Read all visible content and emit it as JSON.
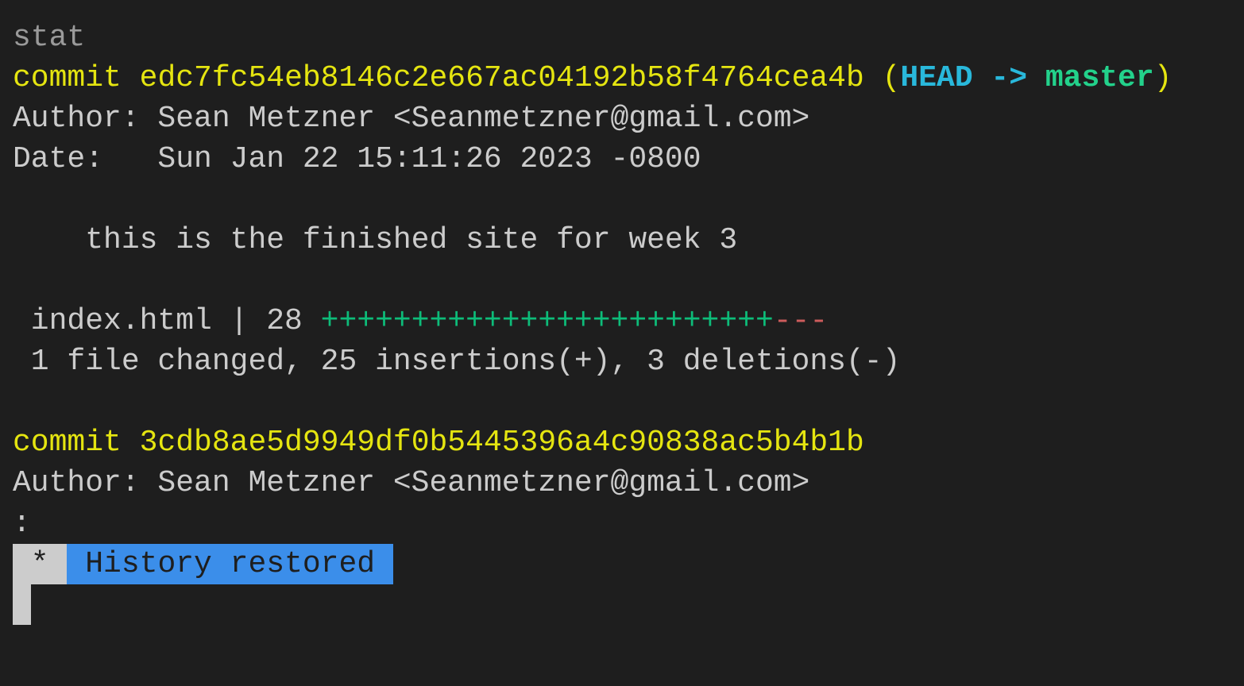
{
  "lines": {
    "prev": "stat",
    "commit1": {
      "label": "commit ",
      "hash": "edc7fc54eb8146c2e667ac04192b58f4764cea4b",
      "open": " (",
      "head": "HEAD",
      "arrow": " -> ",
      "branch": "master",
      "close": ")",
      "author": "Author: Sean Metzner <Seanmetzner@gmail.com>",
      "date": "Date:   Sun Jan 22 15:11:26 2023 -0800",
      "message": "    this is the finished site for week 3",
      "stat_file": " index.html | 28 ",
      "stat_plus": "+++++++++++++++++++++++++",
      "stat_minus": "---",
      "summary": " 1 file changed, 25 insertions(+), 3 deletions(-)"
    },
    "commit2": {
      "label": "commit ",
      "hash": "3cdb8ae5d9949df0b5445396a4c90838ac5b4b1b",
      "author": "Author: Sean Metzner <Seanmetzner@gmail.com>"
    },
    "pager_prompt": ":",
    "status_marker": " * ",
    "status_text": " History restored "
  },
  "colors": {
    "background": "#1e1e1e",
    "text": "#cccccc",
    "hash": "#e5e510",
    "head": "#29b8db",
    "branch": "#23d18b",
    "banner": "#3b8eea"
  }
}
